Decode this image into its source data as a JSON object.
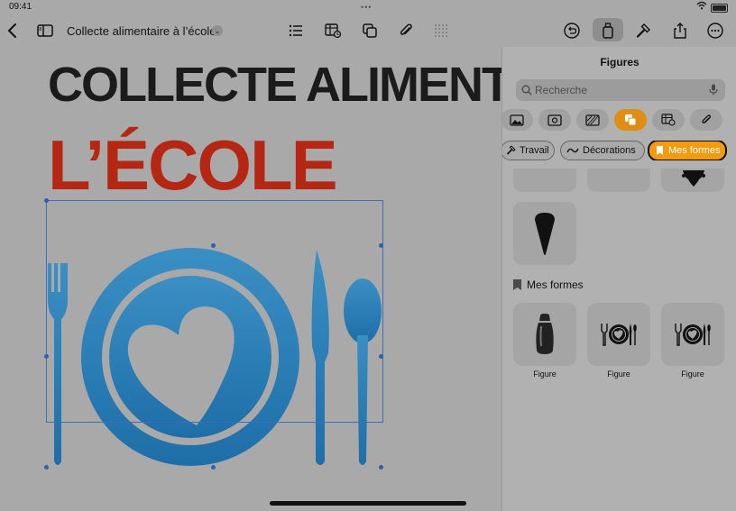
{
  "status_bar": {
    "time": "09:41",
    "dots": "•••"
  },
  "toolbar": {
    "document_title": "Collecte alimentaire à l’école",
    "title_chevron": "⌄"
  },
  "document": {
    "headline_line1": "COLLECTE ALIMENTAIRE À",
    "headline_line2": "L’ÉCOLE"
  },
  "panel": {
    "title": "Figures",
    "search_placeholder": "Recherche",
    "categories": [
      "Travail",
      "Décorations",
      "Mes formes"
    ],
    "section_title": "Mes formes",
    "figure_captions": [
      "Figure",
      "Figure",
      "Figure"
    ]
  },
  "colors": {
    "accent": "#f39a0e",
    "headline_red": "#b52712",
    "artwork_blue": "#2e7fb8"
  }
}
